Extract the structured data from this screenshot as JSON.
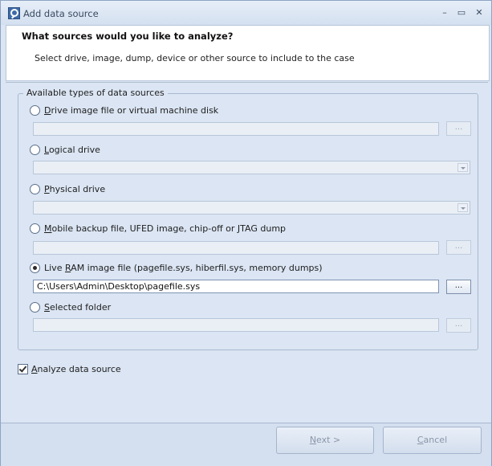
{
  "window": {
    "title": "Add data source",
    "controls": {
      "minimize": "–",
      "maximize": "▭",
      "close": "✕"
    }
  },
  "header": {
    "title": "What sources would you like to analyze?",
    "subtitle": "Select drive, image, dump, device or other source to include to the case"
  },
  "sources": {
    "legend": "Available types of data sources",
    "options": [
      {
        "accel": "D",
        "rest": "rive image file or virtual machine disk",
        "checked": false,
        "value": "",
        "browse": "..."
      },
      {
        "accel": "L",
        "rest": "ogical drive",
        "checked": false,
        "value": ""
      },
      {
        "accel": "P",
        "rest": "hysical drive",
        "checked": false,
        "value": ""
      },
      {
        "accel": "M",
        "rest": "obile backup file, UFED image, chip-off or JTAG dump",
        "checked": false,
        "value": "",
        "browse": "..."
      },
      {
        "prefix": "Live ",
        "accel": "R",
        "rest": "AM image file (pagefile.sys, hiberfil.sys, memory dumps)",
        "checked": true,
        "value": "C:\\Users\\Admin\\Desktop\\pagefile.sys",
        "browse": "..."
      },
      {
        "accel": "S",
        "rest": "elected folder",
        "checked": false,
        "value": "",
        "browse": "..."
      }
    ]
  },
  "analyze": {
    "accel": "A",
    "rest": "nalyze data source",
    "checked": true
  },
  "buttons": {
    "next": {
      "accel": "N",
      "rest": "ext >"
    },
    "cancel": {
      "accel": "C",
      "rest": "ancel"
    }
  }
}
